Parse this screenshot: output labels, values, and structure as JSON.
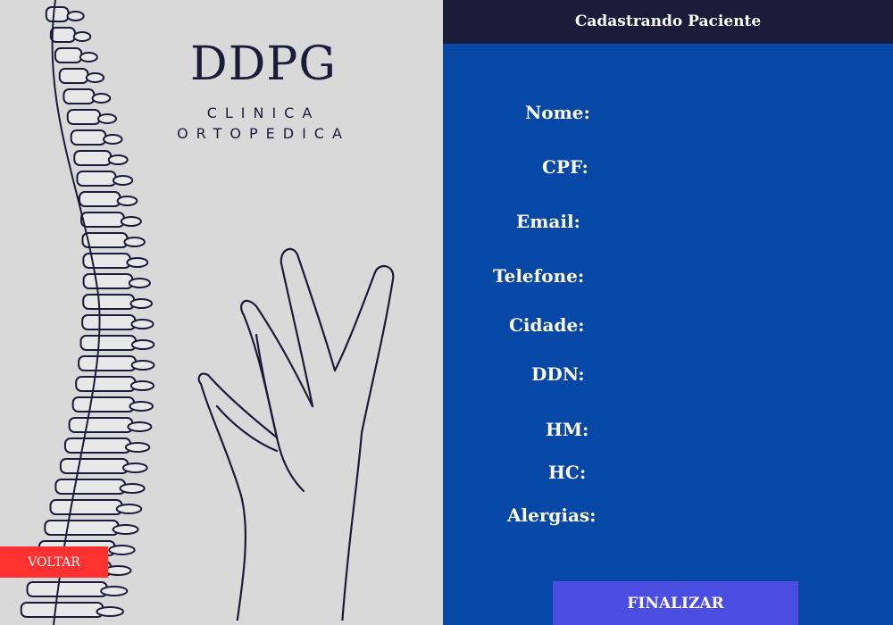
{
  "brand": {
    "title": "DDPG",
    "subtitle_line1": "CLINICA",
    "subtitle_line2": "ORTOPEDICA"
  },
  "form": {
    "title": "Cadastrando Paciente",
    "labels": {
      "nome": "Nome:",
      "cpf": "CPF:",
      "email": "Email:",
      "telefone": "Telefone:",
      "cidade": "Cidade:",
      "ddn": "DDN:",
      "hm": "HM:",
      "hc": "HC:",
      "alergias": "Alergias:"
    },
    "submit_label": "FINALIZAR"
  },
  "nav": {
    "back_label": "VOLTAR"
  },
  "colors": {
    "form_bg": "#0747a6",
    "header_bg": "#1d1b3a",
    "back_button": "#ff3131",
    "submit_button": "#4a4de0",
    "left_bg": "#d9d9d9"
  }
}
